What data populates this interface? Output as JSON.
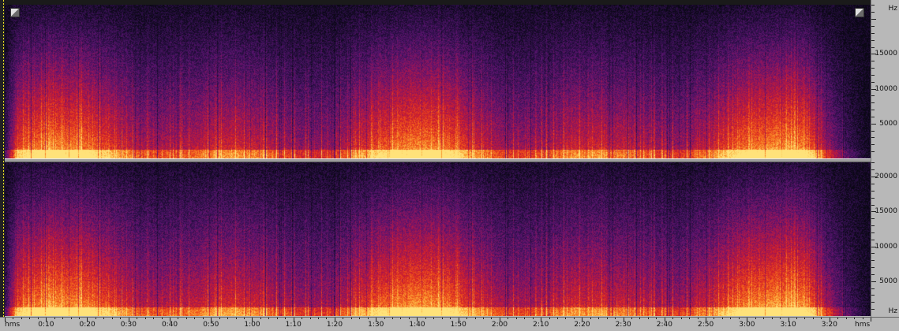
{
  "window": {
    "frequency_unit_top": "Hz",
    "frequency_unit_bottom": "Hz",
    "time_unit_left": "hms",
    "time_unit_right": "hms"
  },
  "frequency_ruler": {
    "channel_1_labels": [
      "15000",
      "10000",
      "5000"
    ],
    "channel_2_labels": [
      "20000",
      "15000",
      "10000",
      "5000"
    ],
    "max_hz": 22050
  },
  "time_ruler": {
    "labels": [
      "0:10",
      "0:20",
      "0:30",
      "0:40",
      "0:50",
      "1:00",
      "1:10",
      "1:20",
      "1:30",
      "1:40",
      "1:50",
      "2:00",
      "2:10",
      "2:20",
      "2:30",
      "2:40",
      "2:50",
      "3:00",
      "3:10",
      "3:20"
    ],
    "total_seconds": 210
  },
  "spectrogram": {
    "channels": 2,
    "color_scale": [
      "#0a0714",
      "#2a0f45",
      "#5a1470",
      "#9a1558",
      "#d11f2a",
      "#f0561a",
      "#fba234",
      "#ffe27a"
    ],
    "fade_out_start_seconds": 196
  }
}
